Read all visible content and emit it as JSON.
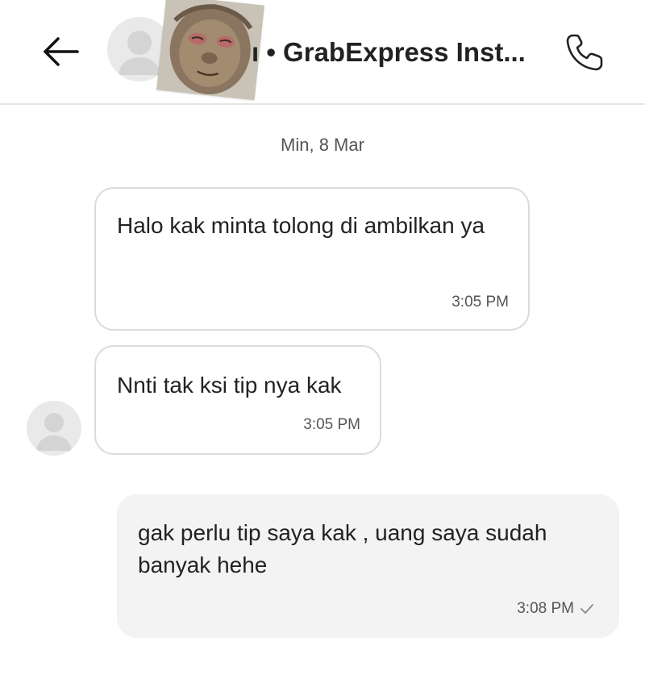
{
  "header": {
    "title": "ı • GrabExpress Inst...",
    "back_icon": "arrow-left-icon",
    "call_icon": "phone-icon"
  },
  "chat": {
    "date": "Min, 8 Mar",
    "messages": [
      {
        "direction": "incoming",
        "text": "Halo kak minta tolong di ambilkan ya",
        "time": "3:05 PM"
      },
      {
        "direction": "incoming",
        "text": "Nnti tak ksi tip nya kak",
        "time": "3:05 PM"
      },
      {
        "direction": "outgoing",
        "text": "gak perlu tip saya kak , uang saya sudah banyak hehe",
        "time": "3:08 PM",
        "status_icon": "check-icon"
      }
    ]
  },
  "colors": {
    "outgoing_bubble": "#f3f3f3",
    "incoming_border": "#dcdcdc",
    "avatar_placeholder": "#e9e9e9"
  }
}
